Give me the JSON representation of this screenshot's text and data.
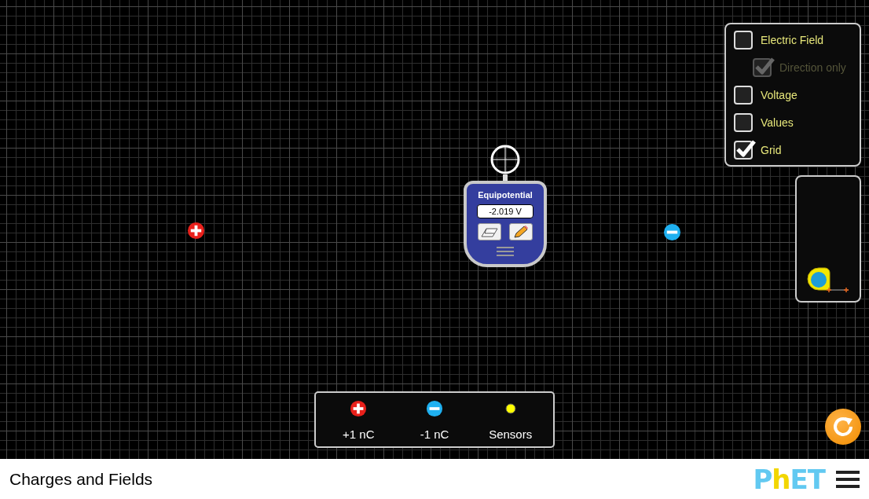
{
  "controls_panel": {
    "items": [
      {
        "label": "Electric Field",
        "checked": false,
        "disabled": false,
        "children": [
          {
            "label": "Direction only",
            "checked": true,
            "disabled": true
          }
        ]
      },
      {
        "label": "Voltage",
        "checked": false,
        "disabled": false
      },
      {
        "label": "Values",
        "checked": false,
        "disabled": false
      },
      {
        "label": "Grid",
        "checked": true,
        "disabled": false
      }
    ]
  },
  "charges_on_canvas": [
    {
      "kind": "positive"
    },
    {
      "kind": "negative"
    }
  ],
  "equipotential_sensor": {
    "title": "Equipotential",
    "reading": "-2.019 V"
  },
  "toolbox": [
    {
      "kind": "positive",
      "label": "+1 nC"
    },
    {
      "kind": "negative",
      "label": "-1 nC"
    },
    {
      "kind": "sensor",
      "label": "Sensors"
    }
  ],
  "nav_bar": {
    "title": "Charges and Fields",
    "logo": "PhET"
  }
}
